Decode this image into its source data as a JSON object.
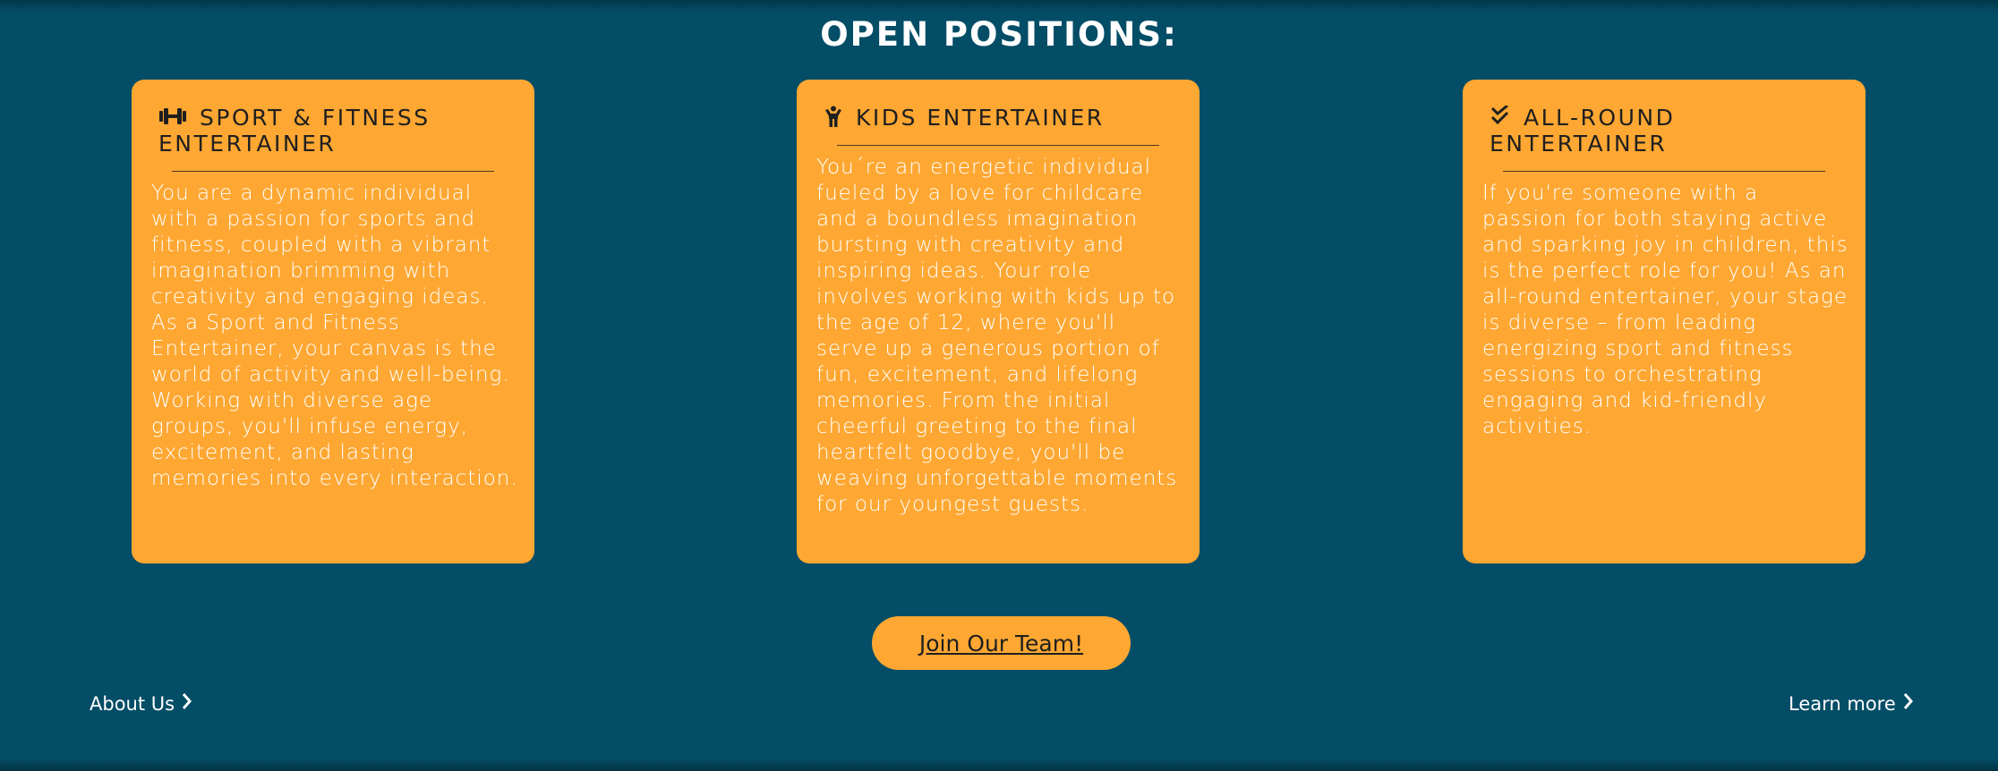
{
  "title": "OPEN POSITIONS:",
  "cards": [
    {
      "icon": "dumbbell-icon",
      "title": "SPORT & FITNESS ENTERTAINER",
      "body": "You are a dynamic individual with a passion for sports and fitness, coupled with a vibrant imagination brimming with creativity and engaging ideas. As a Sport and Fitness Entertainer, your canvas is the world of activity and well-being. Working with diverse age groups, you'll infuse energy, excitement, and lasting memories into every interaction."
    },
    {
      "icon": "child-icon",
      "title": "KIDS ENTERTAINER",
      "body": "You´re an energetic individual fueled by a love for childcare and a boundless imagination bursting with creativity and inspiring ideas. Your role involves working with kids up to the age of 12, where you'll serve up a generous portion of fun, excitement, and lifelong memories. From the initial cheerful greeting to the final heartfelt goodbye, you'll be weaving unforgettable moments for our youngest guests."
    },
    {
      "icon": "double-check-icon",
      "title": "ALL-ROUND ENTERTAINER",
      "body": "If you're someone with a passion for both staying active and sparking joy in children, this is the perfect role for you! As an all-round entertainer, your stage is diverse – from leading energizing sport and fitness sessions to orchestrating engaging and kid-friendly activities."
    }
  ],
  "join_button": "Join Our Team!",
  "footer": {
    "about_label": "About Us",
    "learn_label": "Learn more"
  },
  "colors": {
    "background": "#034d66",
    "card": "#fea732",
    "text_dark": "#1f1f1f",
    "text_light": "#ffffff"
  }
}
